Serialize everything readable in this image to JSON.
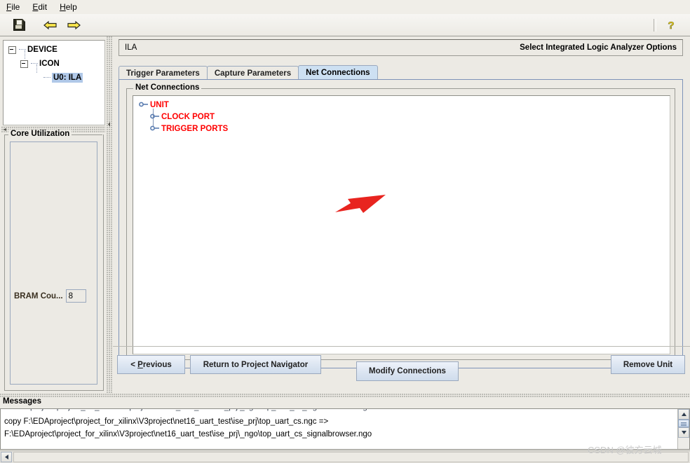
{
  "menu": {
    "items": [
      {
        "label": "File",
        "mnemonic": "F"
      },
      {
        "label": "Edit",
        "mnemonic": "E"
      },
      {
        "label": "Help",
        "mnemonic": "H"
      }
    ]
  },
  "toolbar": {
    "save_icon": "floppy-disk-icon",
    "back_icon": "left-arrow-icon",
    "forward_icon": "right-arrow-icon",
    "help_icon": "question-mark-icon"
  },
  "device_tree": {
    "nodes": [
      {
        "label": "DEVICE",
        "level": 0,
        "expanded": true,
        "selected": false
      },
      {
        "label": "ICON",
        "level": 1,
        "expanded": true,
        "selected": false
      },
      {
        "label": "U0: ILA",
        "level": 2,
        "expanded": false,
        "selected": true
      }
    ]
  },
  "core_utilization": {
    "title": "Core Utilization",
    "bram_label": "BRAM Cou...",
    "bram_value": "8"
  },
  "ila_header": {
    "left": "ILA",
    "right": "Select Integrated Logic Analyzer Options"
  },
  "tabs": [
    {
      "label": "Trigger Parameters",
      "active": false
    },
    {
      "label": "Capture Parameters",
      "active": false
    },
    {
      "label": "Net Connections",
      "active": true
    }
  ],
  "net_connections": {
    "group_title": "Net Connections",
    "tree": [
      {
        "label": "UNIT",
        "level": 0
      },
      {
        "label": "CLOCK PORT",
        "level": 1
      },
      {
        "label": "TRIGGER PORTS",
        "level": 1
      }
    ],
    "annotation": {
      "type": "arrow",
      "color": "#e8241f",
      "points_at": "CLOCK PORT"
    },
    "modify_button": "Modify Connections"
  },
  "buttons": {
    "previous": "< Previous",
    "previous_mnemonic": "P",
    "return": "Return to Project Navigator",
    "remove": "Remove Unit"
  },
  "messages": {
    "title": "Messages",
    "lines": [
      "copy F:\\EDAproject\\project_for_xilinx\\V3project\\net16_uart_test\\ise_prj\\top_uart_cs.ngc =>",
      "F:\\EDAproject\\project_for_xilinx\\V3project\\net16_uart_test\\ise_prj\\_ngo\\top_uart_cs_signalbrowser.ngo"
    ]
  },
  "watermark": "CSDN @彼方云城",
  "colors": {
    "accent_red": "#ff0000",
    "tab_active_bg": "#cde0f2",
    "selection_blue": "#b0c8e8",
    "window_bg": "#eceae4"
  }
}
